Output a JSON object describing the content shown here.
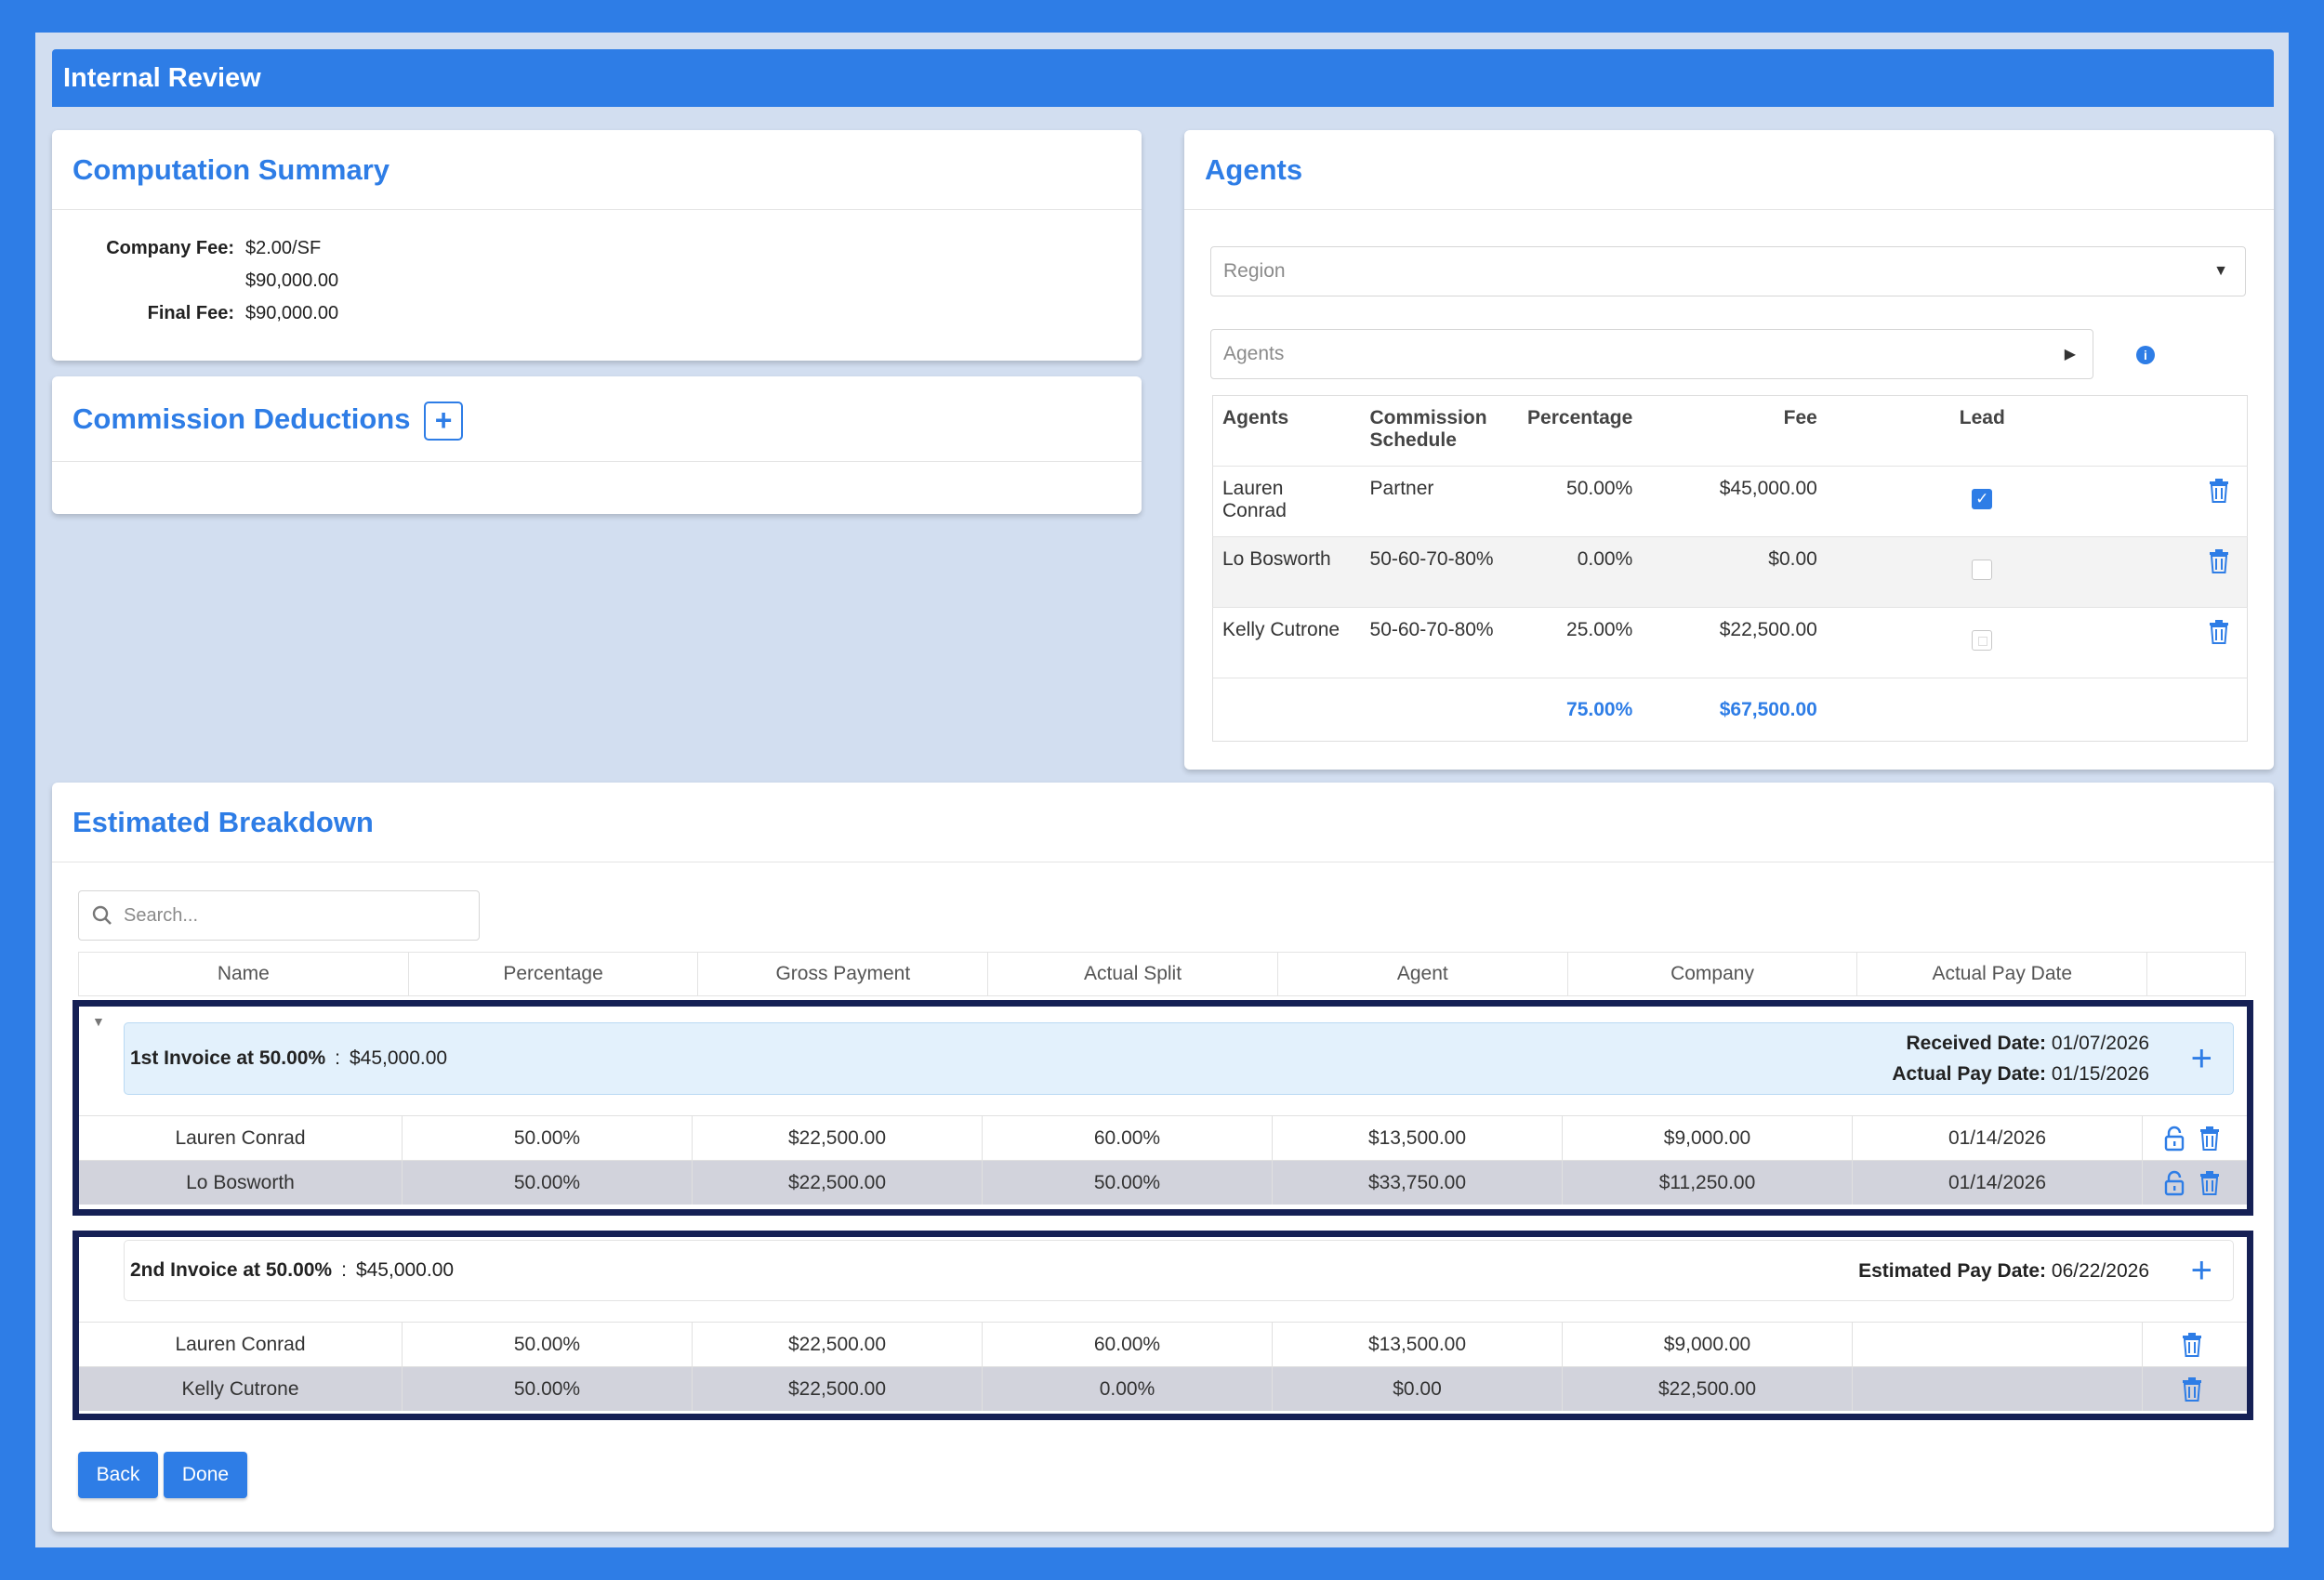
{
  "app": {
    "title": "Internal Review"
  },
  "summary": {
    "title": "Computation Summary",
    "company_fee_label": "Company Fee:",
    "company_fee_rate": "$2.00/SF",
    "company_fee_amount": "$90,000.00",
    "final_fee_label": "Final Fee:",
    "final_fee": "$90,000.00"
  },
  "deductions": {
    "title": "Commission Deductions",
    "add_symbol": "+"
  },
  "agents": {
    "title": "Agents",
    "region_placeholder": "Region",
    "agents_placeholder": "Agents",
    "columns": [
      "Agents",
      "Commission Schedule",
      "Percentage",
      "Fee",
      "Lead"
    ],
    "rows": [
      {
        "name": "Lauren Conrad",
        "schedule": "Partner",
        "percentage": "50.00%",
        "fee": "$45,000.00",
        "lead": true
      },
      {
        "name": "Lo Bosworth",
        "schedule": "50-60-70-80%",
        "percentage": "0.00%",
        "fee": "$0.00",
        "lead": false
      },
      {
        "name": "Kelly Cutrone",
        "schedule": "50-60-70-80%",
        "percentage": "25.00%",
        "fee": "$22,500.00",
        "lead": false
      }
    ],
    "total_percentage": "75.00%",
    "total_fee": "$67,500.00"
  },
  "breakdown": {
    "title": "Estimated Breakdown",
    "search_placeholder": "Search...",
    "columns": [
      "Name",
      "Percentage",
      "Gross Payment",
      "Actual Split",
      "Agent",
      "Company",
      "Actual Pay Date"
    ],
    "invoice1": {
      "label": "1st Invoice at 50.00%",
      "sep": ":",
      "amount": "$45,000.00",
      "received_label": "Received Date:",
      "received_date": "01/07/2026",
      "actual_label": "Actual Pay Date:",
      "actual_date": "01/15/2026",
      "rows": [
        {
          "name": "Lauren Conrad",
          "percentage": "50.00%",
          "gross": "$22,500.00",
          "split": "60.00%",
          "agent": "$13,500.00",
          "company": "$9,000.00",
          "pay_date": "01/14/2026"
        },
        {
          "name": "Lo Bosworth",
          "percentage": "50.00%",
          "gross": "$22,500.00",
          "split": "50.00%",
          "agent": "$33,750.00",
          "company": "$11,250.00",
          "pay_date": "01/14/2026"
        }
      ]
    },
    "invoice2": {
      "label": "2nd Invoice at 50.00%",
      "sep": ":",
      "amount": "$45,000.00",
      "estimated_label": "Estimated Pay Date:",
      "estimated_date": "06/22/2026",
      "rows": [
        {
          "name": "Lauren Conrad",
          "percentage": "50.00%",
          "gross": "$22,500.00",
          "split": "60.00%",
          "agent": "$13,500.00",
          "company": "$9,000.00",
          "pay_date": ""
        },
        {
          "name": "Kelly Cutrone",
          "percentage": "50.00%",
          "gross": "$22,500.00",
          "split": "0.00%",
          "agent": "$0.00",
          "company": "$22,500.00",
          "pay_date": ""
        }
      ]
    },
    "plus_symbol": "+",
    "checkmark": "✓"
  },
  "actions": {
    "back_label": "Back",
    "done_label": "Done"
  },
  "colors": {
    "accent": "#2e7de6",
    "group_border": "#152055",
    "invoice_bg": "#e3f1fc"
  }
}
